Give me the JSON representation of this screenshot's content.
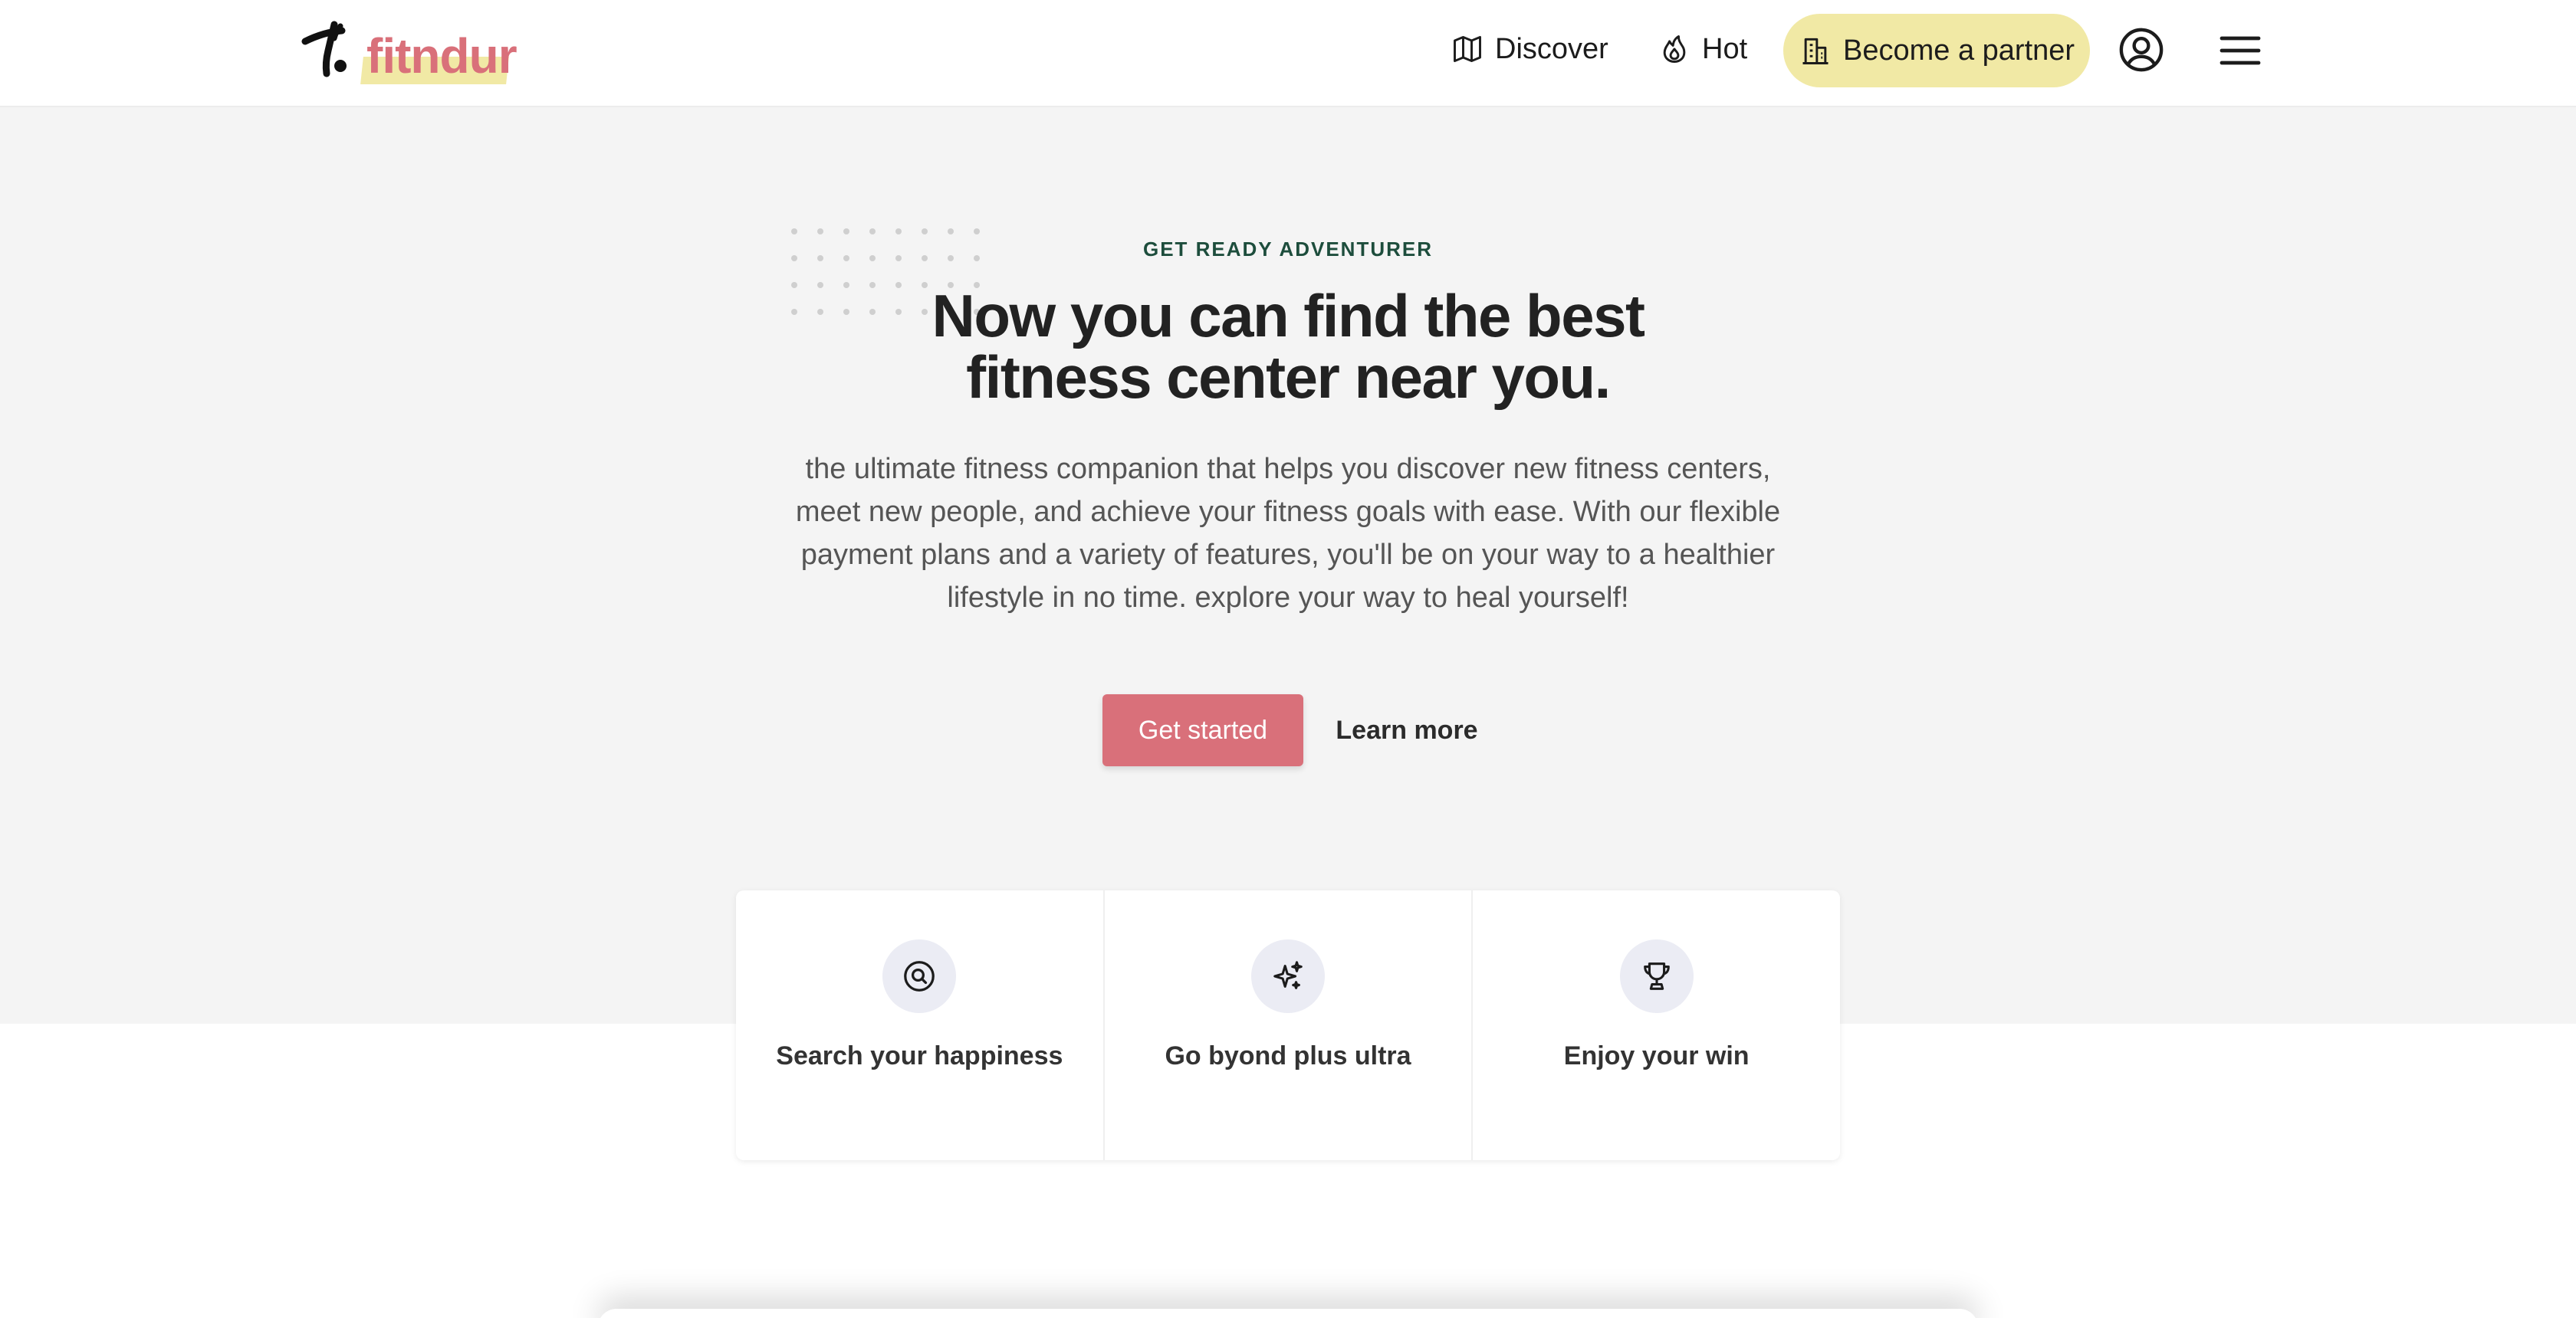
{
  "brand": {
    "name": "fitndur"
  },
  "nav": {
    "discover_label": "Discover",
    "hot_label": "Hot",
    "partner_label": "Become a partner"
  },
  "hero": {
    "eyebrow": "GET READY ADVENTURER",
    "headline_line1": "Now you can find the best",
    "headline_line2": "fitness center near you.",
    "lead": "the ultimate fitness companion that helps you discover new fitness centers, meet new people, and achieve your fitness goals with ease. With our flexible payment plans and a variety of features, you'll be on your way to a healthier lifestyle in no time. explore your way to heal yourself!",
    "cta_primary": "Get started",
    "cta_secondary": "Learn more"
  },
  "features": [
    {
      "title": "Search your happiness",
      "icon": "search-icon"
    },
    {
      "title": "Go byond plus ultra",
      "icon": "sparkles-icon"
    },
    {
      "title": "Enjoy your win",
      "icon": "trophy-icon"
    }
  ],
  "colors": {
    "accent": "#d9707a",
    "highlight": "#f1e9a5",
    "hero_bg": "#f4f4f4",
    "eyebrow": "#1d4d3c"
  }
}
